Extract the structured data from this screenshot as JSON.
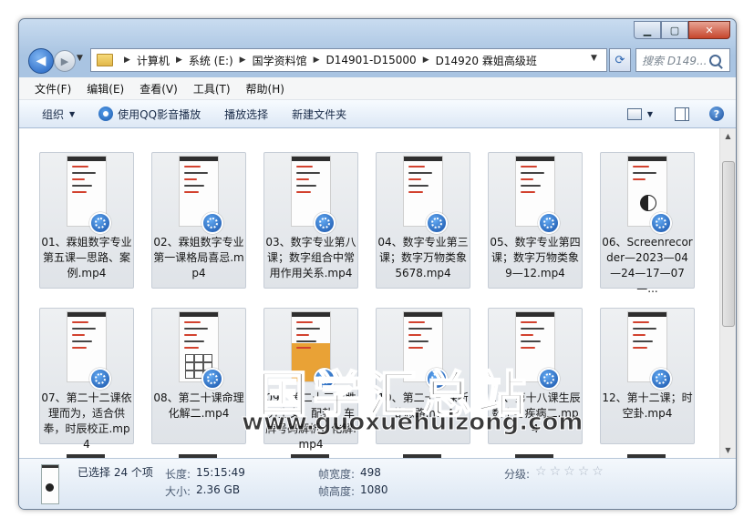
{
  "window": {
    "caption_buttons": [
      "minimize",
      "maximize",
      "close"
    ]
  },
  "address_bar": {
    "crumbs": [
      "计算机",
      "系统 (E:)",
      "国学资料馆",
      "D14901-D15000",
      "D14920 霖姐高级班"
    ],
    "search_placeholder": "搜索 D149..."
  },
  "menu": [
    "文件(F)",
    "编辑(E)",
    "查看(V)",
    "工具(T)",
    "帮助(H)"
  ],
  "toolbar": {
    "organize": "组织",
    "play_qq": "使用QQ影音播放",
    "play_selected": "播放选择",
    "new_folder": "新建文件夹"
  },
  "files": [
    {
      "name": "01、霖姐数字专业第五课—思路、案例.mp4",
      "selected": true,
      "style": "light"
    },
    {
      "name": "02、霖姐数字专业第一课格局喜忌.mp4",
      "selected": true,
      "style": "light"
    },
    {
      "name": "03、数字专业第八课；数字组合中常用作用关系.mp4",
      "selected": true,
      "style": "light"
    },
    {
      "name": "04、数字专业第三课；数字万物类象5678.mp4",
      "selected": true,
      "style": "light"
    },
    {
      "name": "05、数字专业第四课；数字万物类象9—12.mp4",
      "selected": true,
      "style": "light"
    },
    {
      "name": "06、Screenrecorder—2023—04—24—17—07—...",
      "selected": true,
      "style": "bagua"
    },
    {
      "name": "07、第二十二课依理而为，适合供奉，时辰校正.mp4",
      "selected": true,
      "style": "light"
    },
    {
      "name": "08、第二十课命理化解二.mp4",
      "selected": true,
      "style": "grid"
    },
    {
      "name": "09、第二十三课胜男生女，配卦。车牌号码解析，化解.mp4",
      "selected": true,
      "style": "orange"
    },
    {
      "name": "10、第二十一课断卦思路.mp4",
      "selected": true,
      "style": "light"
    },
    {
      "name": "11、第十八课生辰数字与疾病二.mp4",
      "selected": true,
      "style": "light"
    },
    {
      "name": "12、第十二课；时空卦.mp4",
      "selected": true,
      "style": "light"
    }
  ],
  "watermark": {
    "text": "国学汇总站",
    "url": "www.guoxuehuizong.com"
  },
  "details": {
    "selected_count": "已选择 24 个项",
    "length_label": "长度:",
    "length_value": "15:15:49",
    "size_label": "大小:",
    "size_value": "2.36 GB",
    "frame_width_label": "帧宽度:",
    "frame_width_value": "498",
    "frame_height_label": "帧高度:",
    "frame_height_value": "1080",
    "rating_label": "分级:",
    "rating_value": 0,
    "rating_max": 5
  }
}
